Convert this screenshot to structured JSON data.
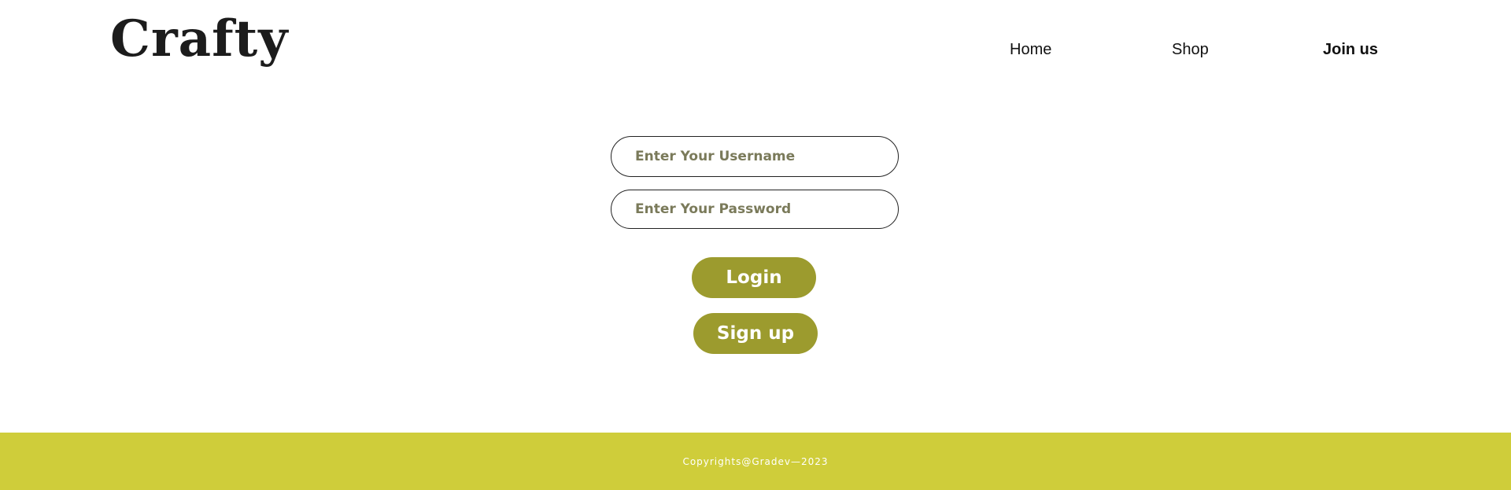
{
  "header": {
    "logo": "Crafty",
    "nav": [
      {
        "label": "Home"
      },
      {
        "label": "Shop"
      },
      {
        "label": "Join us"
      }
    ]
  },
  "form": {
    "username": {
      "placeholder": "Enter Your Username",
      "value": ""
    },
    "password": {
      "placeholder": "Enter Your Password",
      "value": ""
    },
    "login_label": "Login",
    "signup_label": "Sign up"
  },
  "footer": {
    "text": "Copyrights@Gradev—2023"
  },
  "colors": {
    "accent": "#9c9b2e",
    "footer_bg": "#cfcd3a",
    "text": "#111111"
  }
}
